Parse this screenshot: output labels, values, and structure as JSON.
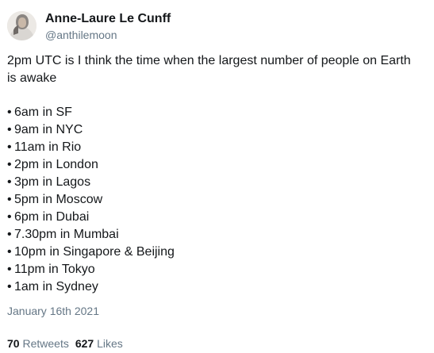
{
  "author": {
    "display_name": "Anne-Laure Le Cunff",
    "handle": "@anthilemoon"
  },
  "tweet": {
    "intro": "2pm UTC is I think the time when the largest number of people on Earth is awake",
    "bullet_symbol": "•",
    "items": [
      "6am in SF",
      "9am in NYC",
      "11am in Rio",
      "2pm in London",
      "3pm in Lagos",
      "5pm in Moscow",
      "6pm in Dubai",
      "7.30pm in Mumbai",
      "10pm in Singapore & Beijing",
      "11pm in Tokyo",
      "1am in Sydney"
    ],
    "date": "January 16th 2021"
  },
  "stats": {
    "retweets_count": "70",
    "retweets_label": "Retweets",
    "likes_count": "627",
    "likes_label": "Likes"
  },
  "colors": {
    "text_primary": "#14171a",
    "text_secondary": "#657786",
    "background": "#ffffff"
  }
}
